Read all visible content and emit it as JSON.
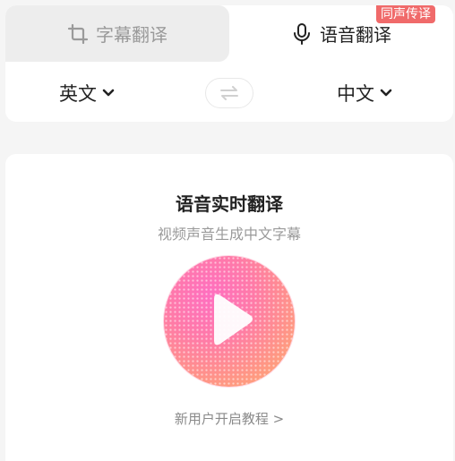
{
  "tabs": {
    "subtitle_translate": {
      "label": "字幕翻译",
      "icon": "crop-icon",
      "active": false
    },
    "voice_translate": {
      "label": "语音翻译",
      "icon": "microphone-icon",
      "active": true,
      "badge": "同声传译"
    }
  },
  "languages": {
    "source": "英文",
    "target": "中文",
    "swap_icon": "swap-icon"
  },
  "main": {
    "title": "语音实时翻译",
    "subtitle": "视频声音生成中文字幕",
    "play_icon": "play-icon",
    "tutorial_link": "新用户开启教程 >"
  },
  "colors": {
    "badge": "#f06a6a",
    "play_gradient_start": "#ff6fc0",
    "play_gradient_end": "#ffb07a"
  }
}
